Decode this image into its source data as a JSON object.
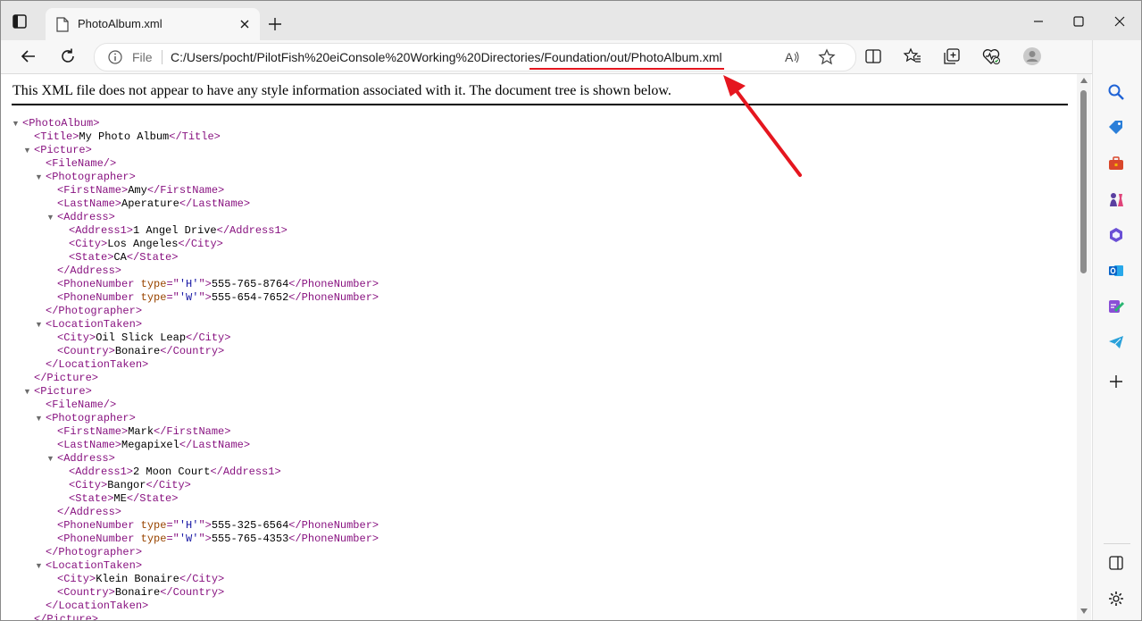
{
  "browser": {
    "tab_title": "PhotoAlbum.xml",
    "address_scheme": "File",
    "address_url": "C:/Users/pocht/PilotFish%20eiConsole%20Working%20Directories/Foundation/out/PhotoAlbum.xml",
    "annotation_color": "#e5161f"
  },
  "page": {
    "notice": "This XML file does not appear to have any style information associated with it. The document tree is shown below."
  },
  "xml_lines": [
    {
      "indent": 0,
      "toggle": true,
      "parts": [
        [
          "tag",
          "<PhotoAlbum>"
        ]
      ]
    },
    {
      "indent": 1,
      "toggle": false,
      "parts": [
        [
          "tag",
          "<Title>"
        ],
        [
          "txt",
          "My Photo Album"
        ],
        [
          "tag",
          "</Title>"
        ]
      ]
    },
    {
      "indent": 1,
      "toggle": true,
      "parts": [
        [
          "tag",
          "<Picture>"
        ]
      ]
    },
    {
      "indent": 2,
      "toggle": false,
      "parts": [
        [
          "tag",
          "<FileName/>"
        ]
      ]
    },
    {
      "indent": 2,
      "toggle": true,
      "parts": [
        [
          "tag",
          "<Photographer>"
        ]
      ]
    },
    {
      "indent": 3,
      "toggle": false,
      "parts": [
        [
          "tag",
          "<FirstName>"
        ],
        [
          "txt",
          "Amy"
        ],
        [
          "tag",
          "</FirstName>"
        ]
      ]
    },
    {
      "indent": 3,
      "toggle": false,
      "parts": [
        [
          "tag",
          "<LastName>"
        ],
        [
          "txt",
          "Aperature"
        ],
        [
          "tag",
          "</LastName>"
        ]
      ]
    },
    {
      "indent": 3,
      "toggle": true,
      "parts": [
        [
          "tag",
          "<Address>"
        ]
      ]
    },
    {
      "indent": 4,
      "toggle": false,
      "parts": [
        [
          "tag",
          "<Address1>"
        ],
        [
          "txt",
          "1 Angel Drive"
        ],
        [
          "tag",
          "</Address1>"
        ]
      ]
    },
    {
      "indent": 4,
      "toggle": false,
      "parts": [
        [
          "tag",
          "<City>"
        ],
        [
          "txt",
          "Los Angeles"
        ],
        [
          "tag",
          "</City>"
        ]
      ]
    },
    {
      "indent": 4,
      "toggle": false,
      "parts": [
        [
          "tag",
          "<State>"
        ],
        [
          "txt",
          "CA"
        ],
        [
          "tag",
          "</State>"
        ]
      ]
    },
    {
      "indent": 3,
      "toggle": false,
      "parts": [
        [
          "tag",
          "</Address>"
        ]
      ]
    },
    {
      "indent": 3,
      "toggle": false,
      "parts": [
        [
          "tag",
          "<PhoneNumber"
        ],
        [
          "txt",
          " "
        ],
        [
          "an",
          "type"
        ],
        [
          "tag",
          "=\""
        ],
        [
          "av",
          "'H'"
        ],
        [
          "tag",
          "\">"
        ],
        [
          "txt",
          "555-765-8764"
        ],
        [
          "tag",
          "</PhoneNumber>"
        ]
      ]
    },
    {
      "indent": 3,
      "toggle": false,
      "parts": [
        [
          "tag",
          "<PhoneNumber"
        ],
        [
          "txt",
          " "
        ],
        [
          "an",
          "type"
        ],
        [
          "tag",
          "=\""
        ],
        [
          "av",
          "'W'"
        ],
        [
          "tag",
          "\">"
        ],
        [
          "txt",
          "555-654-7652"
        ],
        [
          "tag",
          "</PhoneNumber>"
        ]
      ]
    },
    {
      "indent": 2,
      "toggle": false,
      "parts": [
        [
          "tag",
          "</Photographer>"
        ]
      ]
    },
    {
      "indent": 2,
      "toggle": true,
      "parts": [
        [
          "tag",
          "<LocationTaken>"
        ]
      ]
    },
    {
      "indent": 3,
      "toggle": false,
      "parts": [
        [
          "tag",
          "<City>"
        ],
        [
          "txt",
          "Oil Slick Leap"
        ],
        [
          "tag",
          "</City>"
        ]
      ]
    },
    {
      "indent": 3,
      "toggle": false,
      "parts": [
        [
          "tag",
          "<Country>"
        ],
        [
          "txt",
          "Bonaire"
        ],
        [
          "tag",
          "</Country>"
        ]
      ]
    },
    {
      "indent": 2,
      "toggle": false,
      "parts": [
        [
          "tag",
          "</LocationTaken>"
        ]
      ]
    },
    {
      "indent": 1,
      "toggle": false,
      "parts": [
        [
          "tag",
          "</Picture>"
        ]
      ]
    },
    {
      "indent": 1,
      "toggle": true,
      "parts": [
        [
          "tag",
          "<Picture>"
        ]
      ]
    },
    {
      "indent": 2,
      "toggle": false,
      "parts": [
        [
          "tag",
          "<FileName/>"
        ]
      ]
    },
    {
      "indent": 2,
      "toggle": true,
      "parts": [
        [
          "tag",
          "<Photographer>"
        ]
      ]
    },
    {
      "indent": 3,
      "toggle": false,
      "parts": [
        [
          "tag",
          "<FirstName>"
        ],
        [
          "txt",
          "Mark"
        ],
        [
          "tag",
          "</FirstName>"
        ]
      ]
    },
    {
      "indent": 3,
      "toggle": false,
      "parts": [
        [
          "tag",
          "<LastName>"
        ],
        [
          "txt",
          "Megapixel"
        ],
        [
          "tag",
          "</LastName>"
        ]
      ]
    },
    {
      "indent": 3,
      "toggle": true,
      "parts": [
        [
          "tag",
          "<Address>"
        ]
      ]
    },
    {
      "indent": 4,
      "toggle": false,
      "parts": [
        [
          "tag",
          "<Address1>"
        ],
        [
          "txt",
          "2 Moon Court"
        ],
        [
          "tag",
          "</Address1>"
        ]
      ]
    },
    {
      "indent": 4,
      "toggle": false,
      "parts": [
        [
          "tag",
          "<City>"
        ],
        [
          "txt",
          "Bangor"
        ],
        [
          "tag",
          "</City>"
        ]
      ]
    },
    {
      "indent": 4,
      "toggle": false,
      "parts": [
        [
          "tag",
          "<State>"
        ],
        [
          "txt",
          "ME"
        ],
        [
          "tag",
          "</State>"
        ]
      ]
    },
    {
      "indent": 3,
      "toggle": false,
      "parts": [
        [
          "tag",
          "</Address>"
        ]
      ]
    },
    {
      "indent": 3,
      "toggle": false,
      "parts": [
        [
          "tag",
          "<PhoneNumber"
        ],
        [
          "txt",
          " "
        ],
        [
          "an",
          "type"
        ],
        [
          "tag",
          "=\""
        ],
        [
          "av",
          "'H'"
        ],
        [
          "tag",
          "\">"
        ],
        [
          "txt",
          "555-325-6564"
        ],
        [
          "tag",
          "</PhoneNumber>"
        ]
      ]
    },
    {
      "indent": 3,
      "toggle": false,
      "parts": [
        [
          "tag",
          "<PhoneNumber"
        ],
        [
          "txt",
          " "
        ],
        [
          "an",
          "type"
        ],
        [
          "tag",
          "=\""
        ],
        [
          "av",
          "'W'"
        ],
        [
          "tag",
          "\">"
        ],
        [
          "txt",
          "555-765-4353"
        ],
        [
          "tag",
          "</PhoneNumber>"
        ]
      ]
    },
    {
      "indent": 2,
      "toggle": false,
      "parts": [
        [
          "tag",
          "</Photographer>"
        ]
      ]
    },
    {
      "indent": 2,
      "toggle": true,
      "parts": [
        [
          "tag",
          "<LocationTaken>"
        ]
      ]
    },
    {
      "indent": 3,
      "toggle": false,
      "parts": [
        [
          "tag",
          "<City>"
        ],
        [
          "txt",
          "Klein Bonaire"
        ],
        [
          "tag",
          "</City>"
        ]
      ]
    },
    {
      "indent": 3,
      "toggle": false,
      "parts": [
        [
          "tag",
          "<Country>"
        ],
        [
          "txt",
          "Bonaire"
        ],
        [
          "tag",
          "</Country>"
        ]
      ]
    },
    {
      "indent": 2,
      "toggle": false,
      "parts": [
        [
          "tag",
          "</LocationTaken>"
        ]
      ]
    },
    {
      "indent": 1,
      "toggle": false,
      "parts": [
        [
          "tag",
          "</Picture>"
        ]
      ]
    }
  ],
  "toolbar_icons": [
    "back-arrow-icon",
    "refresh-icon",
    "read-aloud-icon",
    "favorite-star-icon",
    "split-screen-icon",
    "favorites-icon",
    "collections-icon",
    "browser-essentials-icon",
    "profile-avatar-icon",
    "bing-copilot-icon"
  ],
  "sidebar_icons": [
    "search-icon",
    "shopping-tag-icon",
    "tools-briefcase-icon",
    "games-chess-icon",
    "microsoft-365-icon",
    "outlook-icon",
    "designer-icon",
    "telegram-icon",
    "add-icon",
    "sidebar-toggle-icon",
    "settings-gear-icon"
  ]
}
